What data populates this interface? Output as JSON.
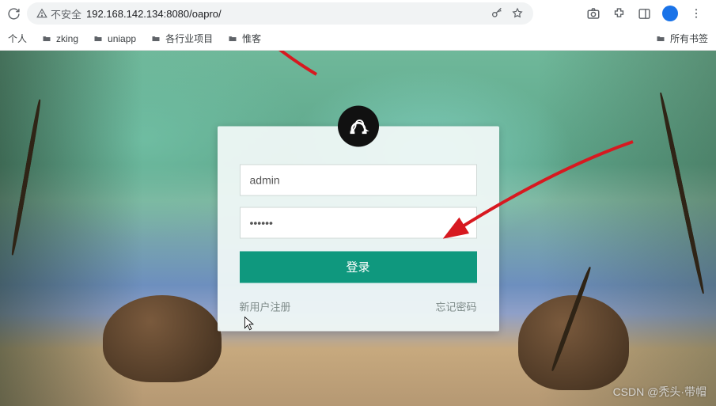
{
  "browser": {
    "security_label": "不安全",
    "url": "192.168.142.134:8080/oapro/"
  },
  "bookmarks": {
    "items": [
      {
        "label": "个人"
      },
      {
        "label": "zking"
      },
      {
        "label": "uniapp"
      },
      {
        "label": "各行业项目"
      },
      {
        "label": "惟客"
      }
    ],
    "overflow_label": "所有书签"
  },
  "login": {
    "logo_name": "omega-icon",
    "username_value": "admin",
    "password_value": "••••••",
    "submit_label": "登录",
    "register_label": "新用户注册",
    "forgot_label": "忘记密码"
  },
  "watermark": "CSDN @秃头·带帽",
  "colors": {
    "accent": "#0f987e",
    "arrow": "#d71920"
  }
}
